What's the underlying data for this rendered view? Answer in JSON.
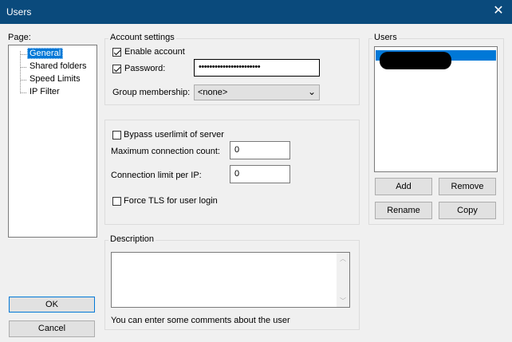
{
  "window": {
    "title": "Users",
    "close_glyph": "✕"
  },
  "page_tree": {
    "label": "Page:",
    "items": [
      {
        "label": "General",
        "selected": true
      },
      {
        "label": "Shared folders",
        "selected": false
      },
      {
        "label": "Speed Limits",
        "selected": false
      },
      {
        "label": "IP Filter",
        "selected": false
      }
    ]
  },
  "account": {
    "group_label": "Account settings",
    "enable_label": "Enable account",
    "enable_checked": true,
    "password_label": "Password:",
    "password_checked": true,
    "password_value": "•••••••••••••••••••••••",
    "group_membership_label": "Group membership:",
    "group_membership_value": "<none>"
  },
  "limits": {
    "bypass_label": "Bypass userlimit of server",
    "bypass_checked": false,
    "max_conn_label": "Maximum connection count:",
    "max_conn_value": "0",
    "conn_per_ip_label": "Connection limit per IP:",
    "conn_per_ip_value": "0",
    "force_tls_label": "Force TLS for user login",
    "force_tls_checked": false
  },
  "description": {
    "group_label": "Description",
    "value": "",
    "hint": "You can enter some comments about the user"
  },
  "users": {
    "group_label": "Users",
    "add_label": "Add",
    "remove_label": "Remove",
    "rename_label": "Rename",
    "copy_label": "Copy"
  },
  "buttons": {
    "ok_label": "OK",
    "cancel_label": "Cancel"
  },
  "colors": {
    "titlebar": "#0a4a7c",
    "selection": "#0078d7",
    "background": "#f0f0f0"
  }
}
